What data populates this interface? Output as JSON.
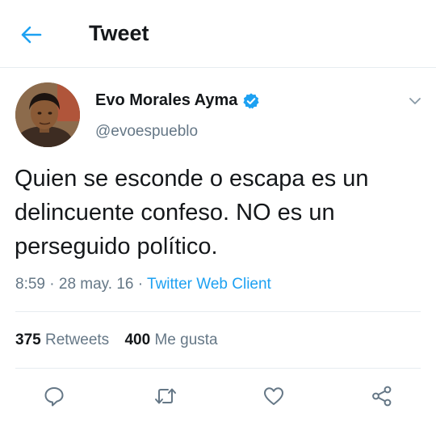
{
  "header": {
    "title": "Tweet",
    "back_icon": "arrow-left-icon"
  },
  "tweet": {
    "author": {
      "name": "Evo Morales Ayma",
      "handle": "@evoespueblo",
      "verified": true
    },
    "text": "Quien se esconde o escapa es un delincuente confeso. NO es un perseguido político.",
    "time": "8:59",
    "separator": " · ",
    "date": "28 may. 16",
    "source": "Twitter Web Client",
    "retweets": {
      "count": "375",
      "label": "Retweets"
    },
    "likes": {
      "count": "400",
      "label": "Me gusta"
    }
  },
  "actions": [
    "reply-icon",
    "retweet-icon",
    "like-icon",
    "share-icon"
  ],
  "colors": {
    "accent": "#1da1f2",
    "secondary_text": "#657786",
    "primary_text": "#14171a",
    "divider": "#e6ecf0"
  }
}
